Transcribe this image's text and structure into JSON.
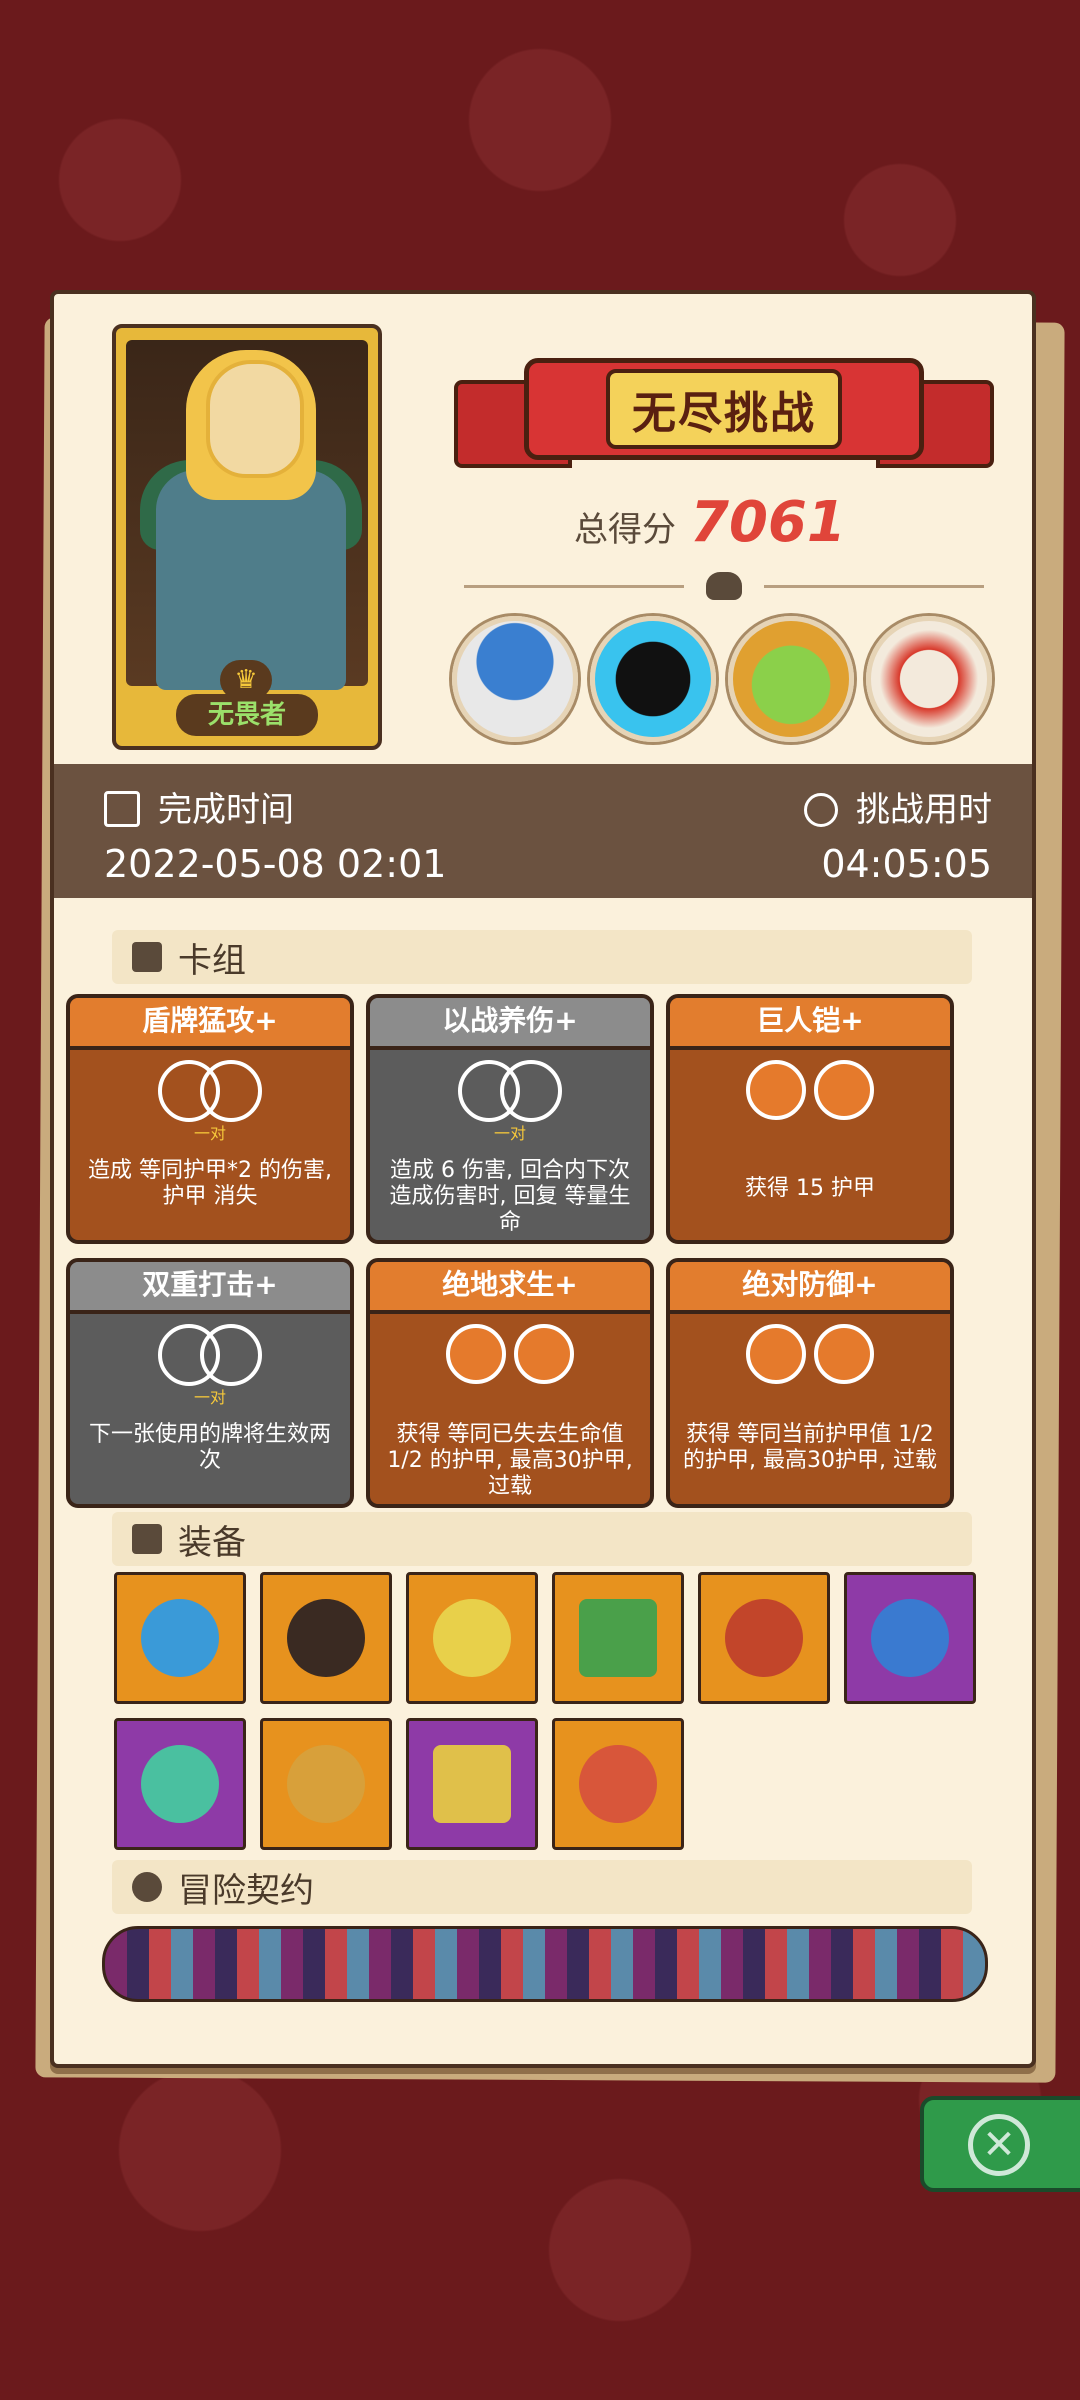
{
  "hero": {
    "name": "无畏者"
  },
  "banner": {
    "title": "无尽挑战"
  },
  "score": {
    "label": "总得分",
    "value": "7061"
  },
  "info": {
    "finish_label": "完成时间",
    "finish_value": "2022-05-08  02:01",
    "duration_label": "挑战用时",
    "duration_value": "04:05:05"
  },
  "sections": {
    "deck": "卡组",
    "equipment": "装备",
    "contracts": "冒险契约"
  },
  "cards": [
    {
      "title": "盾牌猛攻+",
      "pair": "一对",
      "desc": "造成 等同护甲*2 的伤害, 护甲 消失"
    },
    {
      "title": "以战养伤+",
      "pair": "一对",
      "desc": "造成 6 伤害, 回合内下次造成伤害时, 回复 等量生命"
    },
    {
      "title": "巨人铠+",
      "pair": "",
      "desc": "获得 15 护甲"
    },
    {
      "title": "双重打击+",
      "pair": "一对",
      "desc": "下一张使用的牌将生效两次"
    },
    {
      "title": "绝地求生+",
      "pair": "",
      "desc": "获得 等同已失去生命值 1/2 的护甲, 最高30护甲, 过载"
    },
    {
      "title": "绝对防御+",
      "pair": "",
      "desc": "获得 等同当前护甲值 1/2 的护甲, 最高30护甲, 过载"
    }
  ],
  "equipment": [
    {
      "icon": "blue-shield-icon",
      "rarity": "orange"
    },
    {
      "icon": "black-glove-icon",
      "rarity": "orange"
    },
    {
      "icon": "flaming-feather-icon",
      "rarity": "orange"
    },
    {
      "icon": "moss-stone-icon",
      "rarity": "orange"
    },
    {
      "icon": "spiral-amulet-icon",
      "rarity": "orange"
    },
    {
      "icon": "blue-breastplate-icon",
      "rarity": "purple"
    },
    {
      "icon": "demon-mask-icon",
      "rarity": "purple"
    },
    {
      "icon": "tribal-mask-icon",
      "rarity": "orange"
    },
    {
      "icon": "golden-book-icon",
      "rarity": "purple"
    },
    {
      "icon": "meat-drumstick-icon",
      "rarity": "orange"
    }
  ],
  "colors": {
    "accent_red": "#e0453a",
    "panel": "#fbf1dc",
    "infobar": "#6b5240"
  }
}
